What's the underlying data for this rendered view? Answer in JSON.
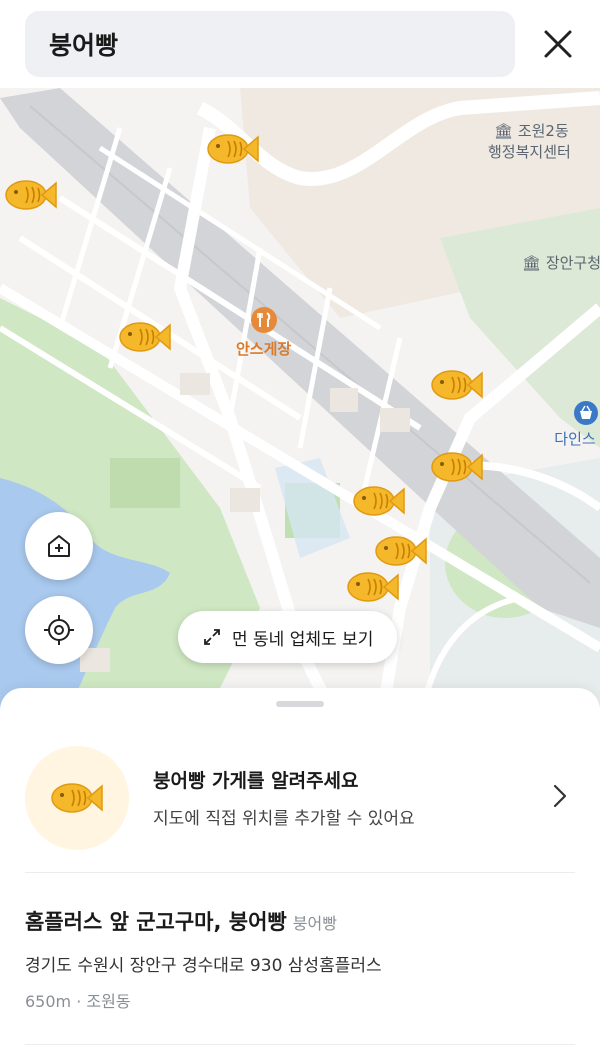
{
  "search": {
    "query": "붕어빵"
  },
  "map": {
    "pois": {
      "gov1_line1": "조원2동",
      "gov1_line2": "행정복지센터",
      "gov2": "장안구청",
      "restaurant": "안스게장",
      "shop": "다인스"
    },
    "nearby_button_label": "먼 동네 업체도 보기",
    "colors": {
      "marker": "#f5b82a",
      "water": "#a9c9ee",
      "park": "#cfe8c3",
      "road": "#ffffff",
      "highway": "#d2d4d7"
    }
  },
  "sheet": {
    "promo": {
      "title": "붕어빵 가게를 알려주세요",
      "subtitle": "지도에 직접 위치를 추가할 수 있어요"
    },
    "store": {
      "name": "홈플러스 앞 군고구마, 붕어빵",
      "category": "붕어빵",
      "address": "경기도 수원시 장안구 경수대로 930 삼성홈플러스",
      "distance": "650m",
      "separator": "·",
      "area": "조원동"
    }
  }
}
